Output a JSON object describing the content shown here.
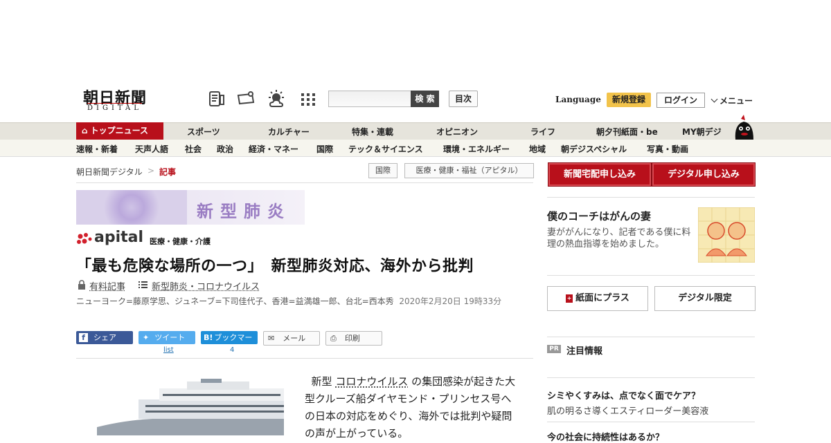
{
  "header": {
    "logo_main": "朝日新聞",
    "logo_sub": "DIGITAL",
    "search_button": "検 索",
    "index_button": "目次",
    "language": "Language",
    "signup": "新規登録",
    "login": "ログイン",
    "menu": "メニュー"
  },
  "nav_primary": [
    "トップニュース",
    "スポーツ",
    "カルチャー",
    "特集・連載",
    "オピニオン",
    "ライフ",
    "朝夕刊紙面・be",
    "MY朝デジ"
  ],
  "nav_secondary": [
    "速報・新着",
    "天声人語",
    "社会",
    "政治",
    "経済・マネー",
    "国際",
    "テック＆サイエンス",
    "環境・エネルギー",
    "地域",
    "朝デジスペシャル",
    "写真・動画"
  ],
  "breadcrumb": {
    "home": "朝日新聞デジタル",
    "sep": ">",
    "current": "記事"
  },
  "tags": [
    "国際",
    "医療・健康・福祉（アピタル）"
  ],
  "banner": {
    "text": "新型肺炎"
  },
  "apital": {
    "name": "apital",
    "sub": "医療・健康・介護"
  },
  "article": {
    "headline": "「最も危険な場所の一つ」　新型肺炎対応、海外から批判",
    "paid_label": "有料記事",
    "series_label": "新型肺炎・コロナウイルス",
    "byline": "ニューヨーク=藤原学思、ジュネーブ=下司佳代子、香港=益満雄一郎、台北=西本秀",
    "timestamp": "2020年2月20日 19時33分",
    "body_start": "新型",
    "body_link": "コロナウイルス",
    "body_rest": "の集団感染が起きた大型クルーズ船ダイヤモンド・プリンセス号への日本の対応をめぐり、海外では批判や疑問の声が上がっている。"
  },
  "share": {
    "facebook": "シェア",
    "twitter": "ツイート",
    "twitter_count": "list",
    "hatena": "ブックマーク",
    "hatena_count": "4",
    "mail": "メール",
    "print": "印刷"
  },
  "sidebar": {
    "btn_paper": "新聞宅配申し込み",
    "btn_digital": "デジタル申し込み",
    "promo_title": "僕のコーチはがんの妻",
    "promo_desc": "妻ががんになり、記者である僕に料理の熱血指導を始めました。",
    "btn_plus": "紙面にプラス",
    "btn_limited": "デジタル限定",
    "pr_badge": "PR",
    "pr_title": "注目情報",
    "ad1_title": "シミやくすみは、点でなく面でケア？",
    "ad1_sub": "肌の明るさ導くエスティローダー美容液",
    "ad2_title": "今の社会に持続性はあるか？"
  },
  "colors": {
    "brand_red": "#b8101b",
    "signup_yellow": "#f2c34b",
    "facebook": "#3b5998",
    "twitter": "#55acee",
    "hatena": "#1e8fd9"
  }
}
